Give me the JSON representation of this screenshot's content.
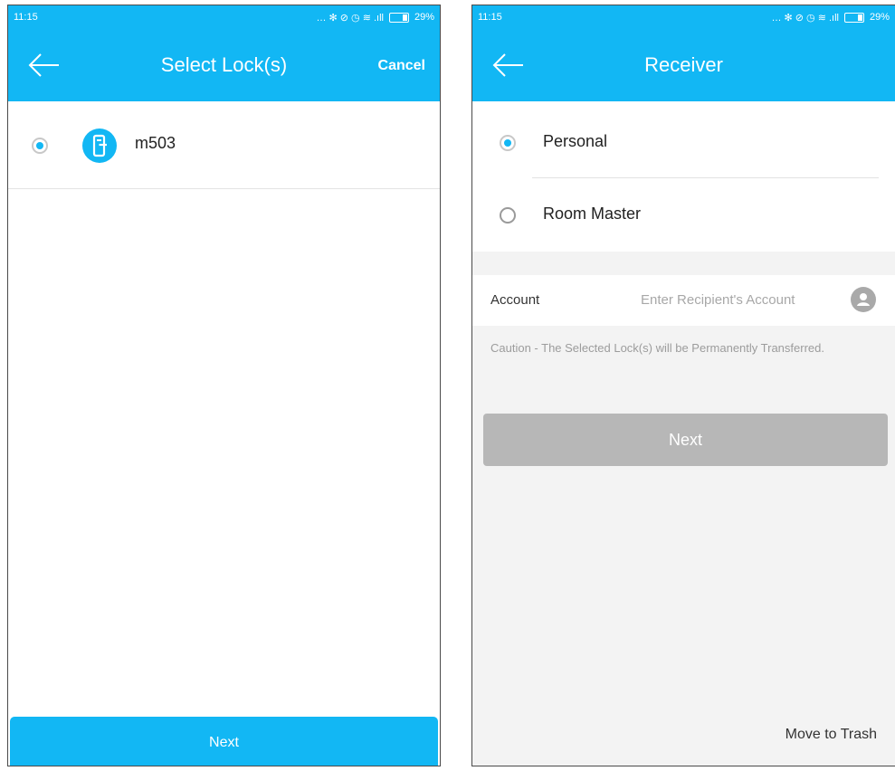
{
  "left": {
    "status": {
      "time": "11:15",
      "indicators": "… ✻ ⊘ ◷ ≋ .ıll",
      "battery": "29%"
    },
    "header": {
      "title": "Select Lock(s)",
      "cancel": "Cancel"
    },
    "locks": [
      {
        "name": "m503",
        "selected": true
      }
    ],
    "next": "Next"
  },
  "right": {
    "status": {
      "time": "11:15",
      "indicators": "… ✻ ⊘ ◷ ≋ .ıll",
      "battery": "29%"
    },
    "header": {
      "title": "Receiver"
    },
    "options": [
      {
        "label": "Personal",
        "selected": true
      },
      {
        "label": "Room Master",
        "selected": false
      }
    ],
    "account": {
      "label": "Account",
      "placeholder": "Enter Recipient's Account"
    },
    "caution": "Caution - The Selected Lock(s) will be Permanently Transferred.",
    "next": "Next",
    "trash": "Move to Trash"
  },
  "colors": {
    "accent": "#12b7f4",
    "disabled_button": "#b7b7b7"
  }
}
